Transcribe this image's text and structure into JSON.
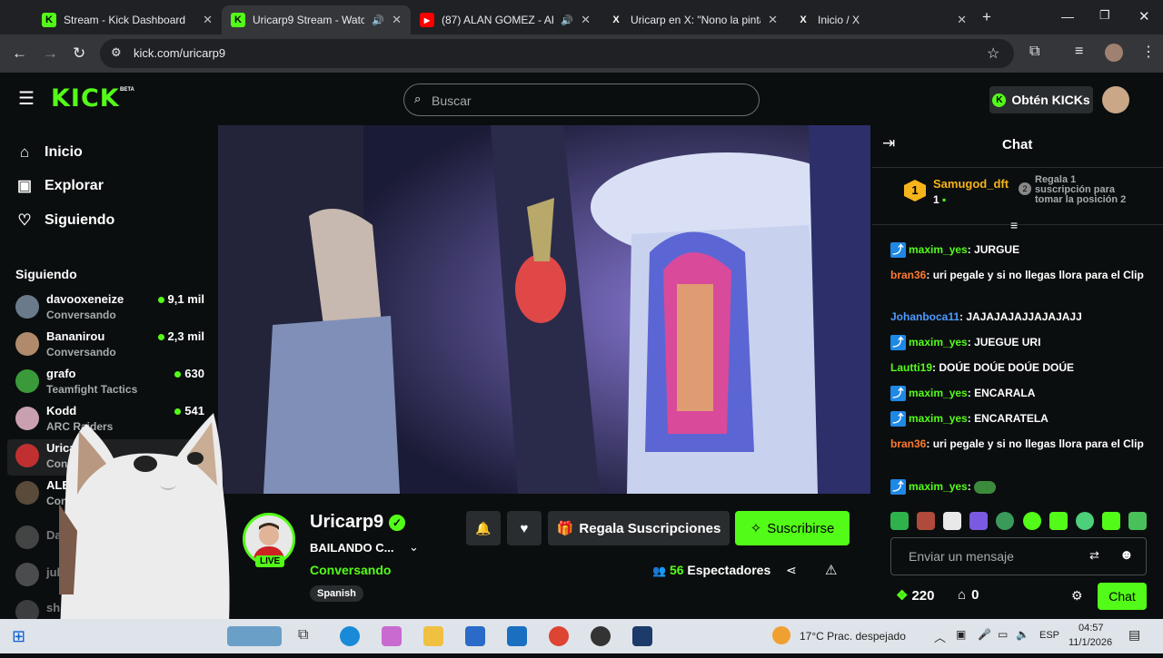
{
  "browser": {
    "tabs": [
      {
        "title": "Stream - Kick Dashboard",
        "fav": "K"
      },
      {
        "title": "Uricarp9 Stream - Watch",
        "fav": "K",
        "audio": "🔊"
      },
      {
        "title": "(87) ALAN GOMEZ - ARI",
        "fav": "▶",
        "audio": "🔊"
      },
      {
        "title": "Uricarp en X: \"Nono la pinta",
        "fav": "X"
      },
      {
        "title": "Inicio / X",
        "fav": "X"
      }
    ],
    "url": "kick.com/uricarp9"
  },
  "header": {
    "logo": "KICK",
    "beta": "BETA",
    "search_placeholder": "Buscar",
    "kicks_button": "Obtén KICKs"
  },
  "sidebar": {
    "nav": [
      {
        "label": "Inicio",
        "icon": "home-icon"
      },
      {
        "label": "Explorar",
        "icon": "explore-icon"
      },
      {
        "label": "Siguiendo",
        "icon": "heart-icon"
      }
    ],
    "following_title": "Siguiendo",
    "channels": [
      {
        "name": "davooxeneize",
        "category": "Conversando",
        "viewers": "9,1 mil"
      },
      {
        "name": "Bananirou",
        "category": "Conversando",
        "viewers": "2,3 mil"
      },
      {
        "name": "grafo",
        "category": "Teamfight Tactics",
        "viewers": "630"
      },
      {
        "name": "Kodd",
        "category": "ARC Raiders",
        "viewers": "541"
      },
      {
        "name": "Uricarp9",
        "category": "Conversando",
        "viewers": ""
      },
      {
        "name": "ALEXITO",
        "category": "Conversando",
        "viewers": ""
      },
      {
        "name": "DarkozTV",
        "category": "",
        "viewers": ""
      },
      {
        "name": "julytal",
        "category": "",
        "viewers": ""
      },
      {
        "name": "sh",
        "category": "",
        "viewers": ""
      }
    ]
  },
  "stream": {
    "channel": "Uricarp9",
    "title": "BAILANDO C...",
    "category": "Conversando",
    "tag": "Spanish",
    "live": "LIVE",
    "gift_button": "Regala Suscripciones",
    "subscribe_button": "Suscribirse",
    "viewers_count": "56",
    "viewers_label": "Espectadores"
  },
  "chat": {
    "title": "Chat",
    "pinned_user": "Samugod_dft",
    "pinned_rank": "1",
    "pinned_count": "1",
    "pinned_text": "Regala 1 suscripción para tomar la posición 2",
    "messages": [
      {
        "user": "maxim_yes",
        "color": "#53fc18",
        "badge": true,
        "text": "JURGUE"
      },
      {
        "user": "bran36",
        "color": "#ff7a2e",
        "badge": false,
        "text": "uri pegale y si no llegas llora para el Clip"
      },
      {
        "user": "Johanboca11",
        "color": "#4d9aff",
        "badge": false,
        "text": "JAJAJAJAJJAJAJAJJ"
      },
      {
        "user": "maxim_yes",
        "color": "#53fc18",
        "badge": true,
        "text": "JUEGUE URI"
      },
      {
        "user": "Lautti19",
        "color": "#53fc18",
        "badge": false,
        "text": "DOÚE DOÚE DOÚE DOÚE"
      },
      {
        "user": "maxim_yes",
        "color": "#53fc18",
        "badge": true,
        "text": "ENCARALA"
      },
      {
        "user": "maxim_yes",
        "color": "#53fc18",
        "badge": true,
        "text": "ENCARATELA"
      },
      {
        "user": "bran36",
        "color": "#ff7a2e",
        "badge": false,
        "text": "uri pegale y si no llegas llora para el Clip"
      },
      {
        "user": "maxim_yes",
        "color": "#53fc18",
        "badge": true,
        "text": ""
      }
    ],
    "input_placeholder": "Enviar un mensaje",
    "points": "220",
    "gifts": "0",
    "send_button": "Chat"
  },
  "taskbar": {
    "weather": "17°C Prac. despejado",
    "lang": "ESP",
    "time": "04:57",
    "date": "11/1/2026"
  },
  "colors": {
    "kick_green": "#53fc18",
    "bg": "#0b0e0f"
  }
}
